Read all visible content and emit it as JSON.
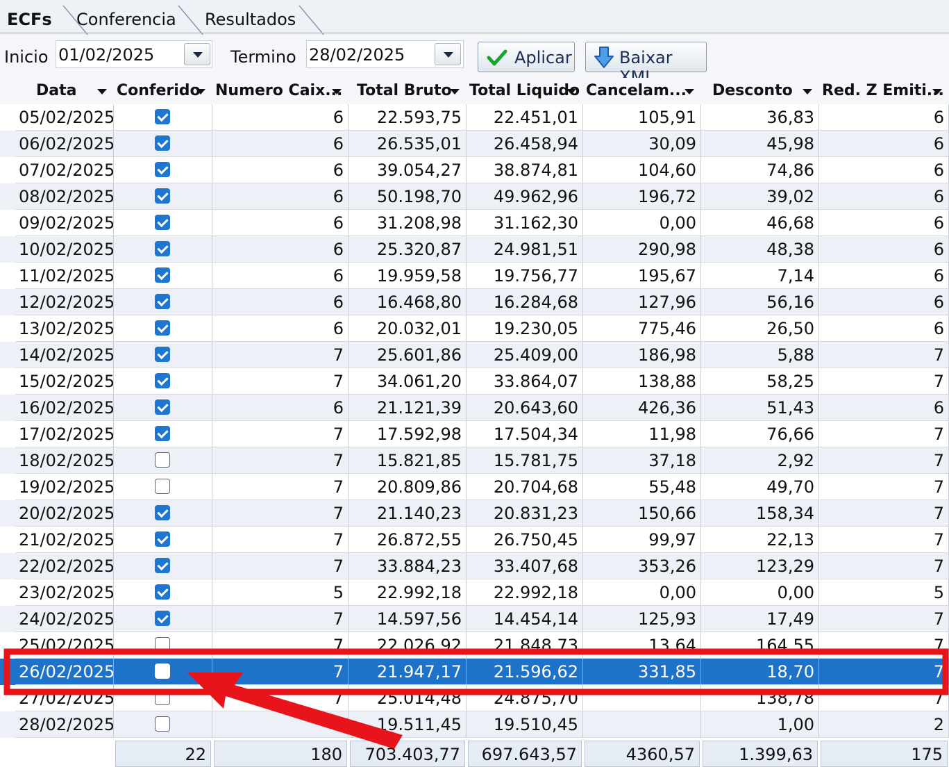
{
  "tabs": [
    {
      "label": "ECFs",
      "active": true
    },
    {
      "label": "Conferencia",
      "active": false
    },
    {
      "label": "Resultados",
      "active": false
    }
  ],
  "filters": {
    "inicio_label": "Inicio",
    "inicio_value": "01/02/2025",
    "termino_label": "Termino",
    "termino_value": "28/02/2025",
    "apply_label": "Aplicar",
    "download_label": "Baixar XML"
  },
  "columns": [
    "Data",
    "Conferido",
    "Numero Caix...",
    "Total Bruto",
    "Total Liquido",
    "Cancelam...",
    "Desconto",
    "Red. Z Emiti..."
  ],
  "rows": [
    [
      "05/02/2025",
      true,
      "6",
      "22.593,75",
      "22.451,01",
      "105,91",
      "36,83",
      "6"
    ],
    [
      "06/02/2025",
      true,
      "6",
      "26.535,01",
      "26.458,94",
      "30,09",
      "45,98",
      "6"
    ],
    [
      "07/02/2025",
      true,
      "6",
      "39.054,27",
      "38.874,81",
      "104,60",
      "74,86",
      "6"
    ],
    [
      "08/02/2025",
      true,
      "6",
      "50.198,70",
      "49.962,96",
      "196,72",
      "39,02",
      "6"
    ],
    [
      "09/02/2025",
      true,
      "6",
      "31.208,98",
      "31.162,30",
      "0,00",
      "46,68",
      "6"
    ],
    [
      "10/02/2025",
      true,
      "6",
      "25.320,87",
      "24.981,51",
      "290,98",
      "48,38",
      "6"
    ],
    [
      "11/02/2025",
      true,
      "6",
      "19.959,58",
      "19.756,77",
      "195,67",
      "7,14",
      "6"
    ],
    [
      "12/02/2025",
      true,
      "6",
      "16.468,80",
      "16.284,68",
      "127,96",
      "56,16",
      "6"
    ],
    [
      "13/02/2025",
      true,
      "6",
      "20.032,01",
      "19.230,05",
      "775,46",
      "26,50",
      "6"
    ],
    [
      "14/02/2025",
      true,
      "7",
      "25.601,86",
      "25.409,00",
      "186,98",
      "5,88",
      "7"
    ],
    [
      "15/02/2025",
      true,
      "7",
      "34.061,20",
      "33.864,07",
      "138,88",
      "58,25",
      "7"
    ],
    [
      "16/02/2025",
      true,
      "6",
      "21.121,39",
      "20.643,60",
      "426,36",
      "51,43",
      "6"
    ],
    [
      "17/02/2025",
      true,
      "7",
      "17.592,98",
      "17.504,34",
      "11,98",
      "76,66",
      "7"
    ],
    [
      "18/02/2025",
      false,
      "7",
      "15.821,85",
      "15.781,75",
      "37,18",
      "2,92",
      "7"
    ],
    [
      "19/02/2025",
      false,
      "7",
      "20.809,86",
      "20.704,68",
      "55,48",
      "49,70",
      "7"
    ],
    [
      "20/02/2025",
      true,
      "7",
      "21.140,23",
      "20.831,23",
      "150,66",
      "158,34",
      "7"
    ],
    [
      "21/02/2025",
      true,
      "7",
      "26.872,55",
      "26.750,45",
      "99,97",
      "22,13",
      "7"
    ],
    [
      "22/02/2025",
      true,
      "7",
      "33.884,23",
      "33.407,68",
      "353,26",
      "123,29",
      "7"
    ],
    [
      "23/02/2025",
      true,
      "5",
      "22.992,18",
      "22.992,18",
      "0,00",
      "0,00",
      "5"
    ],
    [
      "24/02/2025",
      true,
      "7",
      "14.597,56",
      "14.454,14",
      "125,93",
      "17,49",
      "7"
    ],
    [
      "25/02/2025",
      false,
      "7",
      "22.026,92",
      "21.848,73",
      "13,64",
      "164,55",
      "7"
    ],
    [
      "26/02/2025",
      false,
      "7",
      "21.947,17",
      "21.596,62",
      "331,85",
      "18,70",
      "7"
    ],
    [
      "27/02/2025",
      false,
      "7",
      "25.014,48",
      "24.875,70",
      "",
      "138,78",
      "7"
    ],
    [
      "28/02/2025",
      false,
      "",
      "19.511,45",
      "19.510,45",
      "",
      "1,00",
      "2"
    ]
  ],
  "selected_row": 21,
  "totals": [
    "",
    "22",
    "180",
    "703.403,77",
    "697.643,57",
    "4360,57",
    "1.399,63",
    "175"
  ],
  "colors": {
    "selection": "#1e73c8",
    "highlight": "#e8141b",
    "check": "#1f76d0"
  },
  "icons": [
    "dropdown-arrow-icon",
    "checkmark-icon",
    "download-arrow-icon"
  ]
}
